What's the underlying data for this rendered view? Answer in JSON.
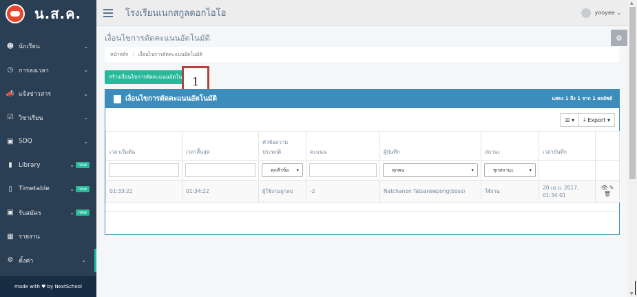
{
  "sidebar": {
    "brand": "น.ส.ค.",
    "items": [
      {
        "label": "นักเรียน",
        "icon": "users-icon",
        "badge": ""
      },
      {
        "label": "การลงเวลา",
        "icon": "clock-icon",
        "badge": ""
      },
      {
        "label": "แจ้งข่าวสาร",
        "icon": "bullhorn-icon",
        "badge": ""
      },
      {
        "label": "วิชาเรียน",
        "icon": "calendar-check-icon",
        "badge": ""
      },
      {
        "label": "SDQ",
        "icon": "book-icon",
        "badge": ""
      },
      {
        "label": "Library",
        "icon": "library-book-icon",
        "badge": "new"
      },
      {
        "label": "Timetable",
        "icon": "file-icon",
        "badge": "new"
      },
      {
        "label": "รับสมัคร",
        "icon": "book-icon",
        "badge": "new"
      },
      {
        "label": "รายงาน",
        "icon": "bar-chart-icon",
        "badge": ""
      },
      {
        "label": "ตั้งค่า",
        "icon": "gears-icon",
        "badge": ""
      }
    ],
    "footer": "made with ♥ by NextSchool"
  },
  "topbar": {
    "school_name": "โรงเรียนเนกสกูลดอกไอโอ",
    "user": "yooyee"
  },
  "page": {
    "title": "เงื่อนไขการตัดคะแนนอัตโนมัติ",
    "breadcrumb_home": "หน้าหลัก",
    "breadcrumb_current": "เงื่อนไขการตัดคะแนนอัตโนมัติ",
    "create_button": "สร้างเงื่อนไขการตัดคะแนนอัตโนมัติ",
    "marker_label": "1"
  },
  "panel": {
    "title": "เงื่อนไขการตัดคะแนนอัตโนมัติ",
    "count_text": "แสดง 1 ถึง 1 จาก 1 ผลลัพธ์",
    "export_label": "Export"
  },
  "table": {
    "headers": [
      "เวลาเริ่มต้น",
      "เวลาสิ้นสุด",
      "หัวข้อความประพฤติ",
      "คะแนน",
      "ผู้บันทึก",
      "สถานะ",
      "เวลาบันทึก",
      ""
    ],
    "filters": {
      "behavior": "ทุกหัวข้อ",
      "recorder": "ทุกคน",
      "status": "ทุกสถานะ"
    },
    "rows": [
      {
        "start": "01:33:22",
        "end": "01:34:22",
        "behavior": "ผู้ใช้งานถูกลบ",
        "score": "-2",
        "recorder": "Natchanon Tatsaneepong(boss)",
        "status": "ใช้งาน",
        "recorded_at": "20 เม.ย. 2017, 01:34:01"
      }
    ]
  },
  "colors": {
    "sidebar_bg": "#2a3f54",
    "accent_green": "#26b99a",
    "panel_blue": "#3c8dbc"
  }
}
